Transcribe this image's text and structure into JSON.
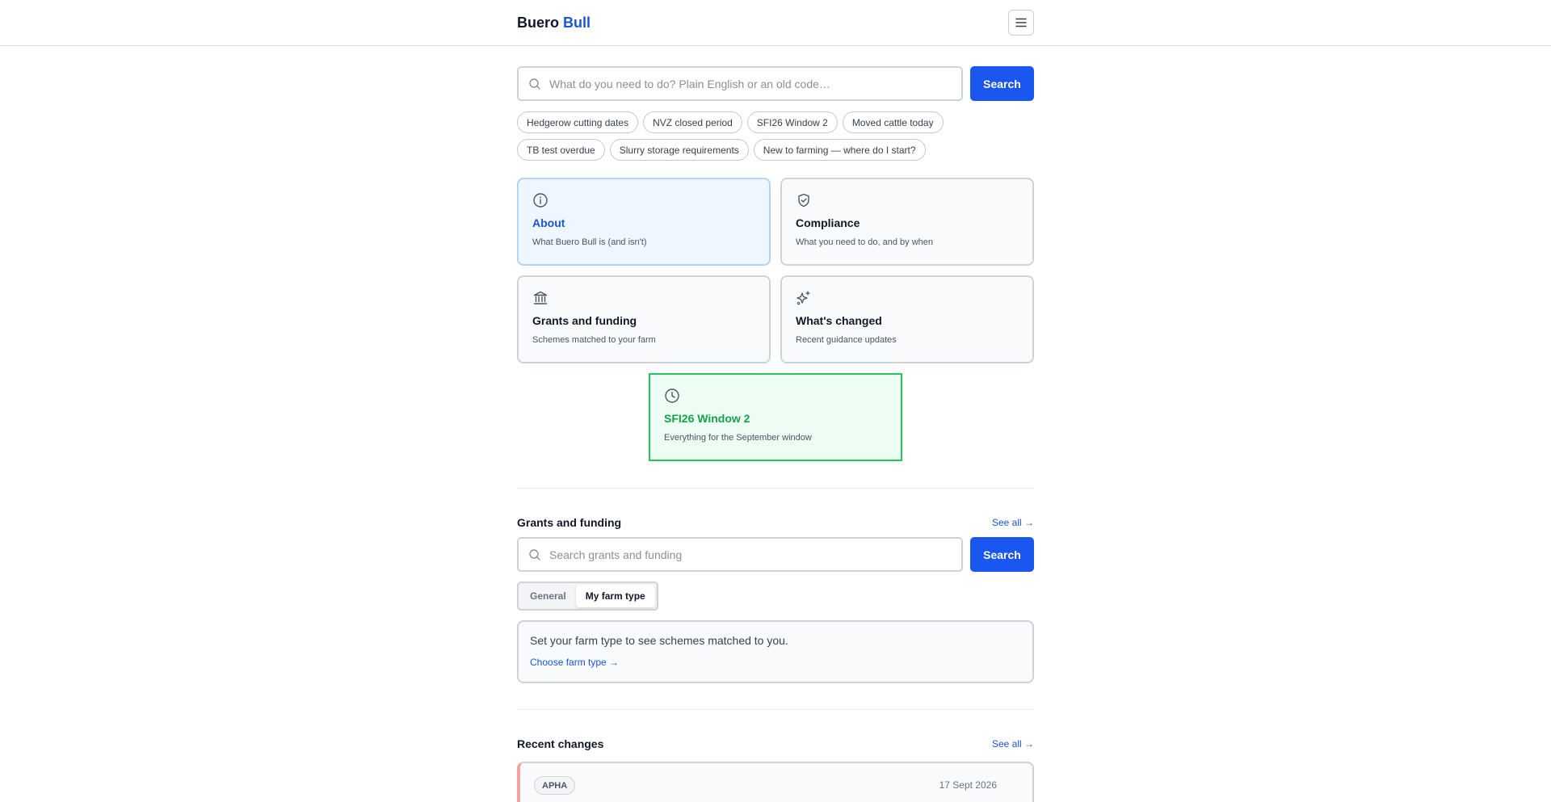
{
  "header": {
    "brand_primary": "Buero",
    "brand_accent": "Bull",
    "menu_icon": "hamburger-menu-icon"
  },
  "search": {
    "placeholder": "What do you need to do? Plain English or an old code…",
    "button_label": "Search"
  },
  "quick_chips": [
    "Hedgerow cutting dates",
    "NVZ closed period",
    "SFI26 Window 2",
    "Moved cattle today",
    "TB test overdue",
    "Slurry storage requirements",
    "New to farming — where do I start?"
  ],
  "cards": {
    "about": {
      "icon": "info-icon",
      "title": "About",
      "desc": "What Buero Bull is (and isn't)"
    },
    "compliance": {
      "icon": "shield-check-icon",
      "title": "Compliance",
      "desc": "What you need to do, and by when"
    },
    "grants": {
      "icon": "bank-icon",
      "title": "Grants and funding",
      "desc": "Schemes matched to your farm"
    },
    "changed": {
      "icon": "sparkles-icon",
      "title": "What's changed",
      "desc": "Recent guidance updates"
    },
    "sfi": {
      "icon": "clock-icon",
      "title": "SFI26 Window 2",
      "desc": "Everything for the September window"
    }
  },
  "grants_section": {
    "title": "Grants and funding",
    "see_all": "See all →",
    "search_placeholder": "Search grants and funding",
    "search_button": "Search",
    "tabs": [
      "General",
      "My farm type"
    ],
    "active_tab": "My farm type",
    "panel_message": "Set your farm type to see schemes matched to you.",
    "panel_link": "Choose farm type →"
  },
  "recent_section": {
    "title": "Recent changes",
    "see_all": "See all →",
    "items": [
      {
        "badge": "APHA",
        "date": "17 Sept 2026"
      }
    ]
  },
  "colors": {
    "accent": "#1a56db",
    "button": "#1a56f0",
    "success": "#22c55e",
    "about_bg": "#eef6ff",
    "sfi_bg": "#eefdf3",
    "change_stripe": "#f3a3a3"
  }
}
